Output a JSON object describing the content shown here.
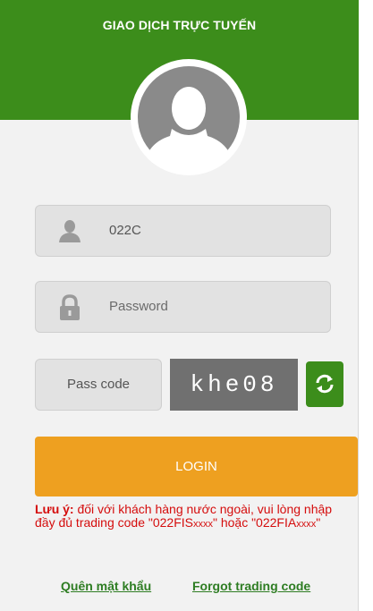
{
  "header": {
    "title": "GIAO DỊCH TRỰC TUYẾN",
    "color": "#3c8d1b"
  },
  "login_form": {
    "username": {
      "value": "022C",
      "icon": "user-icon"
    },
    "password": {
      "placeholder": "Password",
      "icon": "lock-icon"
    },
    "passcode": {
      "placeholder": "Pass code"
    },
    "captcha": {
      "text": "khe08",
      "refresh_icon": "refresh-icon"
    },
    "login_button": {
      "label": "LOGIN",
      "color": "#eea020"
    }
  },
  "note": {
    "prefix": "Lưu ý:",
    "line1": " đối với khách hàng nước ngoài, vui lòng nhập đầy đủ trading code \"022FIS",
    "code1_suffix": "xxxx",
    "line2": "\" hoặc \"022FIA",
    "code2_suffix": "xxxx",
    "line3": "\""
  },
  "links": {
    "forgot_password": "Quên mật khẩu",
    "forgot_trading_code": "Forgot trading code"
  }
}
